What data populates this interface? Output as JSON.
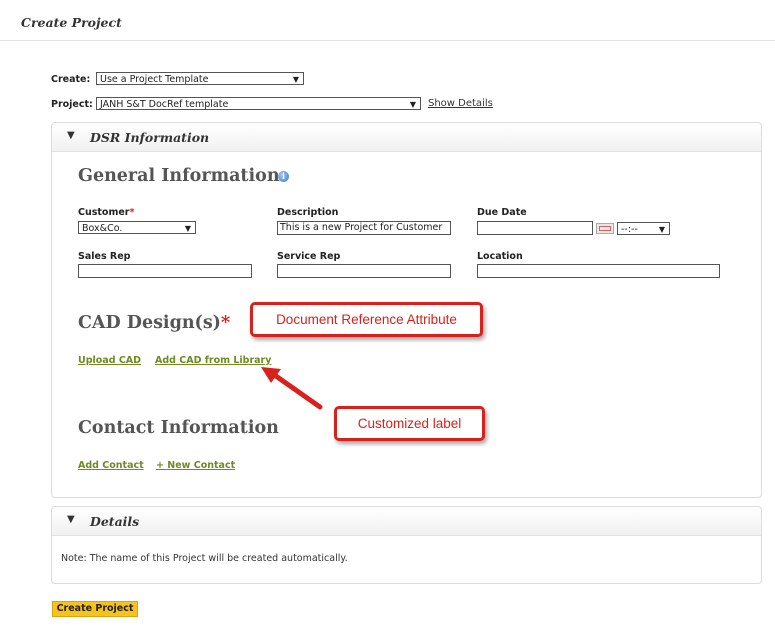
{
  "page": {
    "title": "Create Project"
  },
  "form": {
    "create_label": "Create:",
    "create_value": "Use a Project Template",
    "project_label": "Project:",
    "project_value": "JANH S&T DocRef template",
    "show_details": "Show Details"
  },
  "dsr": {
    "title": "DSR Information",
    "general_info": "General Information",
    "customer_label": "Customer",
    "customer_required": "*",
    "customer_value": "Box&Co.",
    "description_label": "Description",
    "description_value": "This is a new Project for Customer",
    "due_date_label": "Due Date",
    "due_date_value": "",
    "time_value": "--:--",
    "sales_rep_label": "Sales Rep",
    "service_rep_label": "Service Rep",
    "location_label": "Location",
    "cad_heading": "CAD Design(s)",
    "cad_required": "*",
    "upload_cad": "Upload CAD",
    "add_cad_library": "Add CAD from Library",
    "contact_heading": "Contact Information",
    "add_contact": "Add Contact",
    "new_contact": "+ New Contact"
  },
  "annotations": {
    "doc_ref": "Document Reference Attribute",
    "custom_label": "Customized label"
  },
  "details": {
    "title": "Details",
    "note": "Note: The name of this Project will be created automatically."
  },
  "footer": {
    "create_button": "Create Project"
  },
  "colors": {
    "link_green": "#6e8b22",
    "callout_red": "#d9211c",
    "button_yellow": "#f6c21c"
  }
}
